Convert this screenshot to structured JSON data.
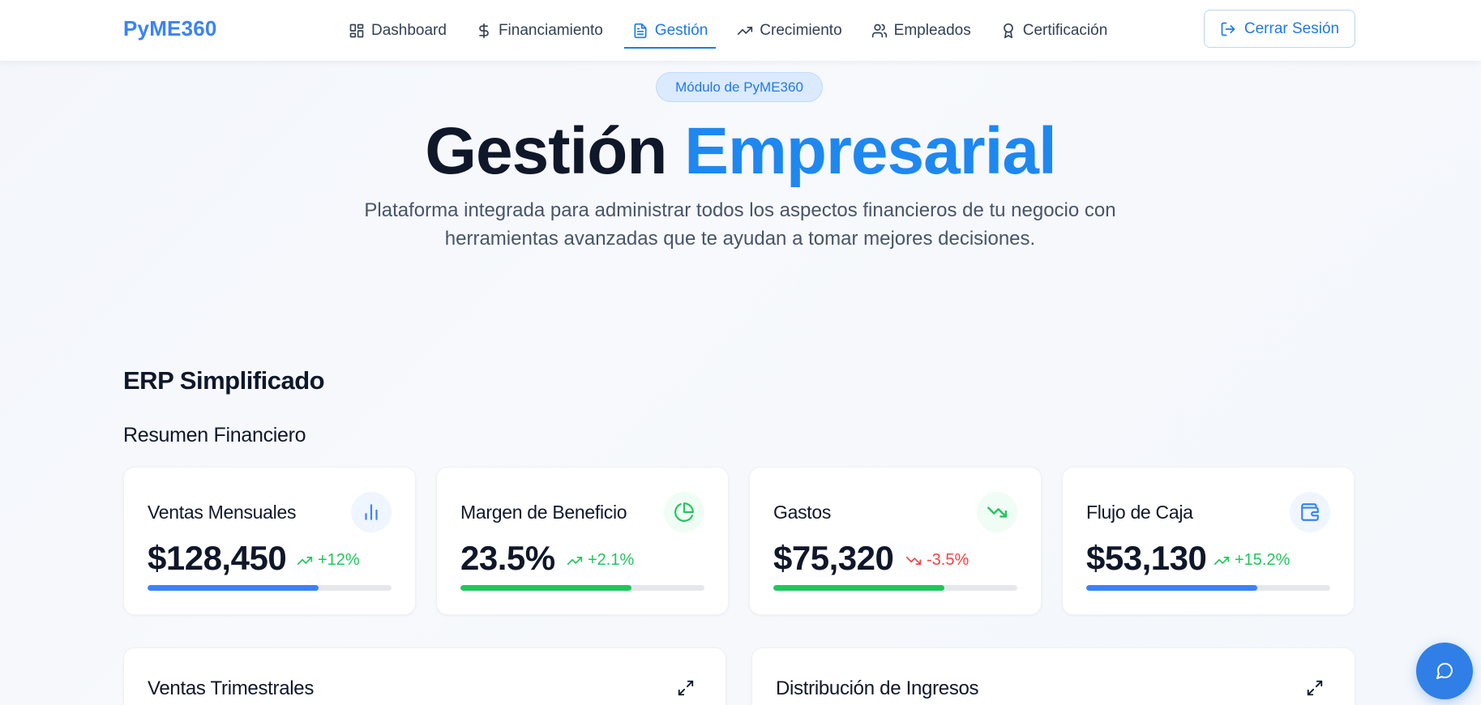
{
  "header": {
    "logo": "PyME360",
    "nav": [
      {
        "label": "Dashboard",
        "icon": "dashboard-icon"
      },
      {
        "label": "Financiamiento",
        "icon": "dollar-icon"
      },
      {
        "label": "Gestión",
        "icon": "document-icon",
        "active": true
      },
      {
        "label": "Crecimiento",
        "icon": "trending-up-icon"
      },
      {
        "label": "Empleados",
        "icon": "users-icon"
      },
      {
        "label": "Certificación",
        "icon": "award-icon"
      }
    ],
    "logout_label": "Cerrar Sesión"
  },
  "hero": {
    "badge": "Módulo de PyME360",
    "title_main": "Gestión",
    "title_accent": "Empresarial",
    "subtitle": "Plataforma integrada para administrar todos los aspectos financieros de tu negocio con herramientas avanzadas que te ayudan a tomar mejores decisiones."
  },
  "section": {
    "title": "ERP Simplificado",
    "subtitle": "Resumen Financiero"
  },
  "kpis": [
    {
      "title": "Ventas Mensuales",
      "value": "$128,450",
      "change": "+12%",
      "trend": "up",
      "progress": 0.7,
      "icon": "bar-chart-icon",
      "bar_color": "#3b82f6"
    },
    {
      "title": "Margen de Beneficio",
      "value": "23.5%",
      "change": "+2.1%",
      "trend": "up",
      "progress": 0.7,
      "icon": "pie-chart-icon",
      "bar_color": "#22c55e"
    },
    {
      "title": "Gastos",
      "value": "$75,320",
      "change": "-3.5%",
      "trend": "down",
      "progress": 0.7,
      "icon": "trending-down-icon",
      "bar_color": "#22c55e"
    },
    {
      "title": "Flujo de Caja",
      "value": "$53,130",
      "change": "+15.2%",
      "trend": "up",
      "progress": 0.7,
      "icon": "wallet-icon",
      "bar_color": "#3b82f6"
    }
  ],
  "charts": [
    {
      "title": "Ventas Trimestrales"
    },
    {
      "title": "Distribución de Ingresos"
    }
  ],
  "colors": {
    "accent": "#1e7ae6",
    "positive": "#22c55e",
    "negative": "#ef4444"
  }
}
